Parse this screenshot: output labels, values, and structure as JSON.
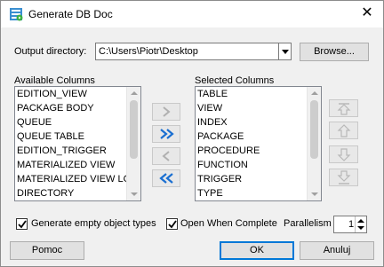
{
  "window": {
    "title": "Generate DB Doc",
    "close_glyph": "✕"
  },
  "output": {
    "label": "Output directory:",
    "path": "C:\\Users\\Piotr\\Desktop",
    "browse_label": "Browse..."
  },
  "available": {
    "label": "Available Columns",
    "items": [
      "EDITION_VIEW",
      "PACKAGE BODY",
      "QUEUE",
      "QUEUE TABLE",
      "EDITION_TRIGGER",
      "MATERIALIZED VIEW",
      "MATERIALIZED VIEW LOG",
      "DIRECTORY"
    ]
  },
  "selected": {
    "label": "Selected Columns",
    "items": [
      "TABLE",
      "VIEW",
      "INDEX",
      "PACKAGE",
      "PROCEDURE",
      "FUNCTION",
      "TRIGGER",
      "TYPE"
    ]
  },
  "options": {
    "generate_empty_label": "Generate empty object types",
    "generate_empty_checked": true,
    "open_when_complete_label": "Open When Complete",
    "open_when_complete_checked": true,
    "parallelism_label": "Parallelism",
    "parallelism_value": "1"
  },
  "footer": {
    "help_label": "Pomoc",
    "ok_label": "OK",
    "cancel_label": "Anuluj"
  },
  "colors": {
    "accent": "#0078d7",
    "arrow_blue": "#1a6fd1",
    "arrow_gray": "#b0b0b0"
  }
}
